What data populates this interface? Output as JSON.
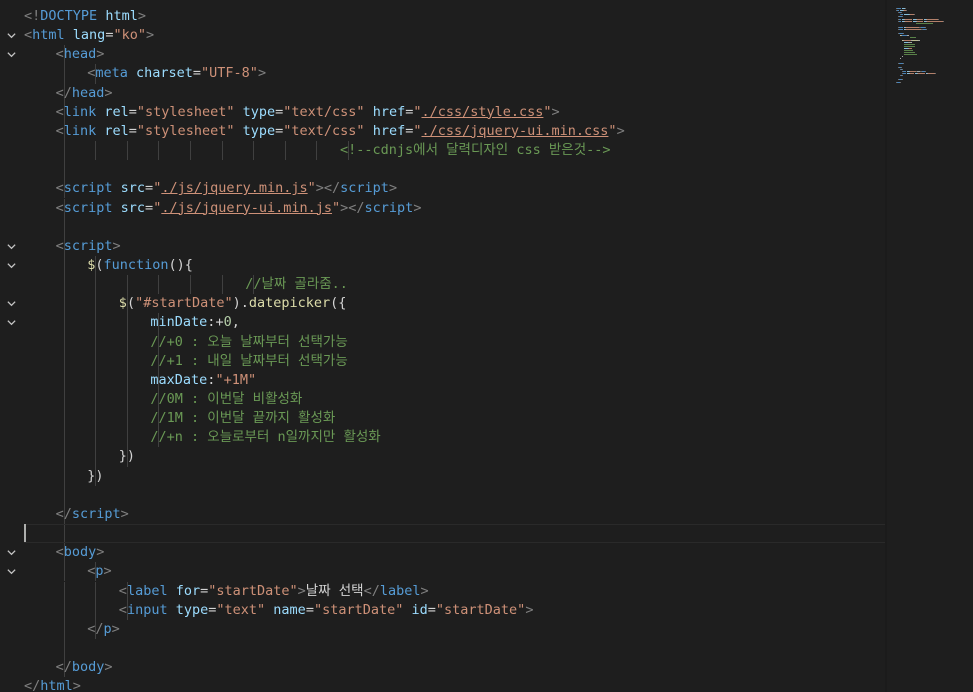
{
  "editor": {
    "lines": [
      [
        {
          "t": "<!",
          "c": "br"
        },
        {
          "t": "DOCTYPE",
          "c": "tag"
        },
        {
          "t": " ",
          "c": "txt"
        },
        {
          "t": "html",
          "c": "attr"
        },
        {
          "t": ">",
          "c": "br"
        }
      ],
      [
        {
          "t": "<",
          "c": "br"
        },
        {
          "t": "html",
          "c": "tag"
        },
        {
          "t": " ",
          "c": "txt"
        },
        {
          "t": "lang",
          "c": "attr"
        },
        {
          "t": "=",
          "c": "txt"
        },
        {
          "t": "\"ko\"",
          "c": "str"
        },
        {
          "t": ">",
          "c": "br"
        }
      ],
      [
        {
          "t": "<",
          "c": "br"
        },
        {
          "t": "head",
          "c": "tag"
        },
        {
          "t": ">",
          "c": "br"
        }
      ],
      [
        {
          "t": "<",
          "c": "br"
        },
        {
          "t": "meta",
          "c": "tag"
        },
        {
          "t": " ",
          "c": "txt"
        },
        {
          "t": "charset",
          "c": "attr"
        },
        {
          "t": "=",
          "c": "txt"
        },
        {
          "t": "\"UTF-8\"",
          "c": "str"
        },
        {
          "t": ">",
          "c": "br"
        }
      ],
      [
        {
          "t": "</",
          "c": "br"
        },
        {
          "t": "head",
          "c": "tag"
        },
        {
          "t": ">",
          "c": "br"
        }
      ],
      [
        {
          "t": "<",
          "c": "br"
        },
        {
          "t": "link",
          "c": "tag"
        },
        {
          "t": " ",
          "c": "txt"
        },
        {
          "t": "rel",
          "c": "attr"
        },
        {
          "t": "=",
          "c": "txt"
        },
        {
          "t": "\"stylesheet\"",
          "c": "str"
        },
        {
          "t": " ",
          "c": "txt"
        },
        {
          "t": "type",
          "c": "attr"
        },
        {
          "t": "=",
          "c": "txt"
        },
        {
          "t": "\"text/css\"",
          "c": "str"
        },
        {
          "t": " ",
          "c": "txt"
        },
        {
          "t": "href",
          "c": "attr"
        },
        {
          "t": "=",
          "c": "txt"
        },
        {
          "t": "\"",
          "c": "str"
        },
        {
          "t": "./css/style.css",
          "c": "str",
          "u": true
        },
        {
          "t": "\"",
          "c": "str"
        },
        {
          "t": ">",
          "c": "br"
        }
      ],
      [
        {
          "t": "<",
          "c": "br"
        },
        {
          "t": "link",
          "c": "tag"
        },
        {
          "t": " ",
          "c": "txt"
        },
        {
          "t": "rel",
          "c": "attr"
        },
        {
          "t": "=",
          "c": "txt"
        },
        {
          "t": "\"stylesheet\"",
          "c": "str"
        },
        {
          "t": " ",
          "c": "txt"
        },
        {
          "t": "type",
          "c": "attr"
        },
        {
          "t": "=",
          "c": "txt"
        },
        {
          "t": "\"text/css\"",
          "c": "str"
        },
        {
          "t": " ",
          "c": "txt"
        },
        {
          "t": "href",
          "c": "attr"
        },
        {
          "t": "=",
          "c": "txt"
        },
        {
          "t": "\"",
          "c": "str"
        },
        {
          "t": "./css/jquery-ui.min.css",
          "c": "str",
          "u": true
        },
        {
          "t": "\"",
          "c": "str"
        },
        {
          "t": ">",
          "c": "br"
        }
      ],
      [
        {
          "t": "<!--cdnjs에서 달력디자인 css 받은것-->",
          "c": "com"
        }
      ],
      [],
      [
        {
          "t": "<",
          "c": "br"
        },
        {
          "t": "script",
          "c": "tag"
        },
        {
          "t": " ",
          "c": "txt"
        },
        {
          "t": "src",
          "c": "attr"
        },
        {
          "t": "=",
          "c": "txt"
        },
        {
          "t": "\"",
          "c": "str"
        },
        {
          "t": "./js/jquery.min.js",
          "c": "str",
          "u": true
        },
        {
          "t": "\"",
          "c": "str"
        },
        {
          "t": "></",
          "c": "br"
        },
        {
          "t": "script",
          "c": "tag"
        },
        {
          "t": ">",
          "c": "br"
        }
      ],
      [
        {
          "t": "<",
          "c": "br"
        },
        {
          "t": "script",
          "c": "tag"
        },
        {
          "t": " ",
          "c": "txt"
        },
        {
          "t": "src",
          "c": "attr"
        },
        {
          "t": "=",
          "c": "txt"
        },
        {
          "t": "\"",
          "c": "str"
        },
        {
          "t": "./js/jquery-ui.min.js",
          "c": "str",
          "u": true
        },
        {
          "t": "\"",
          "c": "str"
        },
        {
          "t": "></",
          "c": "br"
        },
        {
          "t": "script",
          "c": "tag"
        },
        {
          "t": ">",
          "c": "br"
        }
      ],
      [],
      [
        {
          "t": "<",
          "c": "br"
        },
        {
          "t": "script",
          "c": "tag"
        },
        {
          "t": ">",
          "c": "br"
        }
      ],
      [
        {
          "t": "$",
          "c": "fn"
        },
        {
          "t": "(",
          "c": "txt"
        },
        {
          "t": "function",
          "c": "tag"
        },
        {
          "t": "(){",
          "c": "txt"
        }
      ],
      [
        {
          "t": "//날짜 골라줌..",
          "c": "com"
        }
      ],
      [
        {
          "t": "$",
          "c": "fn"
        },
        {
          "t": "(",
          "c": "txt"
        },
        {
          "t": "\"#startDate\"",
          "c": "str"
        },
        {
          "t": ").",
          "c": "txt"
        },
        {
          "t": "datepicker",
          "c": "fn"
        },
        {
          "t": "({",
          "c": "txt"
        }
      ],
      [
        {
          "t": "minDate",
          "c": "var"
        },
        {
          "t": ":",
          "c": "txt"
        },
        {
          "t": "+",
          "c": "op"
        },
        {
          "t": "0",
          "c": "num"
        },
        {
          "t": ",",
          "c": "txt"
        }
      ],
      [
        {
          "t": "//+0 : 오늘 날짜부터 선택가능",
          "c": "com"
        }
      ],
      [
        {
          "t": "//+1 : 내일 날짜부터 선택가능",
          "c": "com"
        }
      ],
      [
        {
          "t": "maxDate",
          "c": "var"
        },
        {
          "t": ":",
          "c": "txt"
        },
        {
          "t": "\"+1M\"",
          "c": "str"
        }
      ],
      [
        {
          "t": "//0M : 이번달 비활성화",
          "c": "com"
        }
      ],
      [
        {
          "t": "//1M : 이번달 끝까지 활성화",
          "c": "com"
        }
      ],
      [
        {
          "t": "//+n : 오늘로부터 n일까지만 활성화",
          "c": "com"
        }
      ],
      [
        {
          "t": "})",
          "c": "txt"
        }
      ],
      [
        {
          "t": "})",
          "c": "txt"
        }
      ],
      [],
      [
        {
          "t": "</",
          "c": "br"
        },
        {
          "t": "script",
          "c": "tag"
        },
        {
          "t": ">",
          "c": "br"
        }
      ],
      [],
      [
        {
          "t": "<",
          "c": "br"
        },
        {
          "t": "body",
          "c": "tag"
        },
        {
          "t": ">",
          "c": "br"
        }
      ],
      [
        {
          "t": "<",
          "c": "br"
        },
        {
          "t": "p",
          "c": "tag"
        },
        {
          "t": ">",
          "c": "br"
        }
      ],
      [
        {
          "t": "<",
          "c": "br"
        },
        {
          "t": "label",
          "c": "tag"
        },
        {
          "t": " ",
          "c": "txt"
        },
        {
          "t": "for",
          "c": "attr"
        },
        {
          "t": "=",
          "c": "txt"
        },
        {
          "t": "\"startDate\"",
          "c": "str"
        },
        {
          "t": ">",
          "c": "br"
        },
        {
          "t": "날짜 선택",
          "c": "txt"
        },
        {
          "t": "</",
          "c": "br"
        },
        {
          "t": "label",
          "c": "tag"
        },
        {
          "t": ">",
          "c": "br"
        }
      ],
      [
        {
          "t": "<",
          "c": "br"
        },
        {
          "t": "input",
          "c": "tag"
        },
        {
          "t": " ",
          "c": "txt"
        },
        {
          "t": "type",
          "c": "attr"
        },
        {
          "t": "=",
          "c": "txt"
        },
        {
          "t": "\"text\"",
          "c": "str"
        },
        {
          "t": " ",
          "c": "txt"
        },
        {
          "t": "name",
          "c": "attr"
        },
        {
          "t": "=",
          "c": "txt"
        },
        {
          "t": "\"startDate\"",
          "c": "str"
        },
        {
          "t": " ",
          "c": "txt"
        },
        {
          "t": "id",
          "c": "attr"
        },
        {
          "t": "=",
          "c": "txt"
        },
        {
          "t": "\"startDate\"",
          "c": "str"
        },
        {
          "t": ">",
          "c": "br"
        }
      ],
      [
        {
          "t": "</",
          "c": "br"
        },
        {
          "t": "p",
          "c": "tag"
        },
        {
          "t": ">",
          "c": "br"
        }
      ],
      [],
      [
        {
          "t": "</",
          "c": "br"
        },
        {
          "t": "body",
          "c": "tag"
        },
        {
          "t": ">",
          "c": "br"
        }
      ],
      [
        {
          "t": "</",
          "c": "br"
        },
        {
          "t": "html",
          "c": "tag"
        },
        {
          "t": ">",
          "c": "br"
        }
      ]
    ],
    "fold_lines": [
      1,
      2,
      12,
      13,
      15,
      16,
      28,
      29
    ],
    "colors": {
      "background": "#1e1e1e",
      "tag": "#569cd6",
      "attribute": "#9cdcfe",
      "string": "#ce9178",
      "comment": "#6a9955",
      "function": "#dcdcaa",
      "number": "#b5cea8",
      "bracket": "#808080",
      "text": "#d4d4d4"
    },
    "icons": {
      "fold": "chevron-down-icon"
    }
  }
}
